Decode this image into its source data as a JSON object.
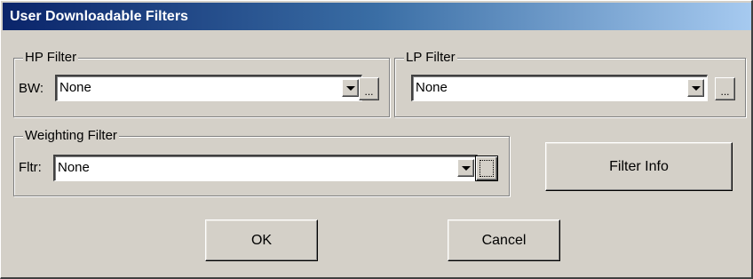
{
  "window": {
    "title": "User Downloadable Filters"
  },
  "hp_filter": {
    "group_label": "HP Filter",
    "field_label": "BW:",
    "selected_value": "None",
    "browse_label": "..."
  },
  "lp_filter": {
    "group_label": "LP Filter",
    "selected_value": "None",
    "browse_label": "..."
  },
  "weighting_filter": {
    "group_label": "Weighting Filter",
    "field_label": "Fltr:",
    "selected_value": "None"
  },
  "buttons": {
    "filter_info": "Filter Info",
    "ok": "OK",
    "cancel": "Cancel"
  },
  "colors": {
    "dialog_face": "#d4d0c8",
    "title_gradient_start": "#0a246a",
    "title_gradient_end": "#a6caf0",
    "title_text": "#ffffff"
  },
  "icons": {
    "dropdown": "chevron-down-icon"
  }
}
